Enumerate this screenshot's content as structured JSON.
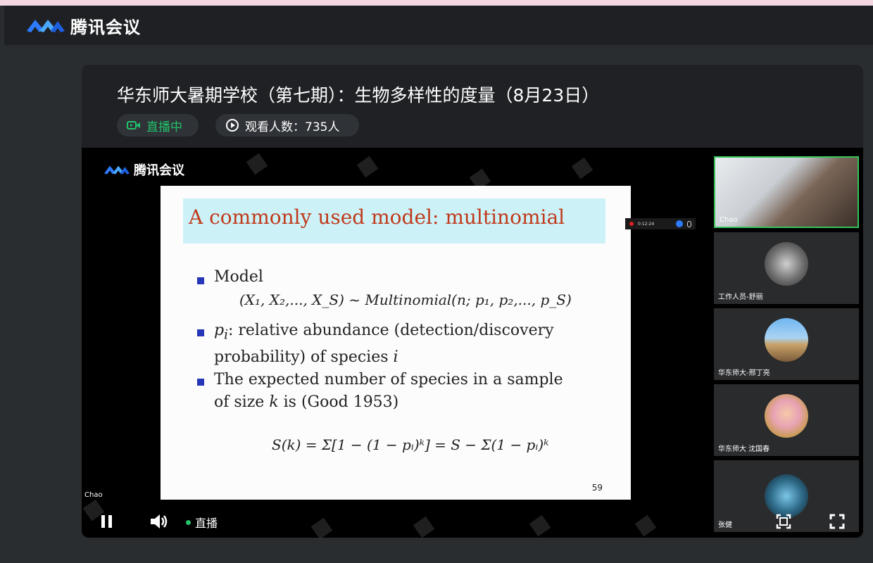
{
  "app": {
    "name": "腾讯会议"
  },
  "meeting": {
    "title": "华东师大暑期学校（第七期）：生物多样性的度量（8月23日）",
    "status": "直播中",
    "viewers": "观看人数：735人"
  },
  "slide": {
    "heading": "A commonly used model: multinomial",
    "b1": "Model",
    "f1": "(X₁, X₂,..., X_S) ~ Multinomial(n; p₁, p₂,..., p_S)",
    "b2a": "p",
    "b2sub": "i",
    "b2b": ": relative abundance (detection/discovery",
    "b2c": "probability) of  species ",
    "b2i": "i",
    "b3a": "The expected number of species in a sample",
    "b3b": "of size ",
    "b3k": "k",
    "b3c": " is (Good 1953)",
    "f2": "S(k) = Σ[1 − (1 − pᵢ)ᵏ] = S − Σ(1 − pᵢ)ᵏ",
    "page": "59"
  },
  "recording": {
    "time": "0:12:24"
  },
  "participants": [
    {
      "name": "Chao"
    },
    {
      "name": "工作人员-舒丽"
    },
    {
      "name": "华东师大-邢丁亮"
    },
    {
      "name": "华东师大 沈国春"
    },
    {
      "name": "张健"
    }
  ],
  "controls": {
    "speaker": "Chao",
    "live_label": "直播"
  },
  "colors": {
    "live_green": "#22c26b",
    "accent_blue": "#2d7bff",
    "slide_red": "#c0391b"
  }
}
